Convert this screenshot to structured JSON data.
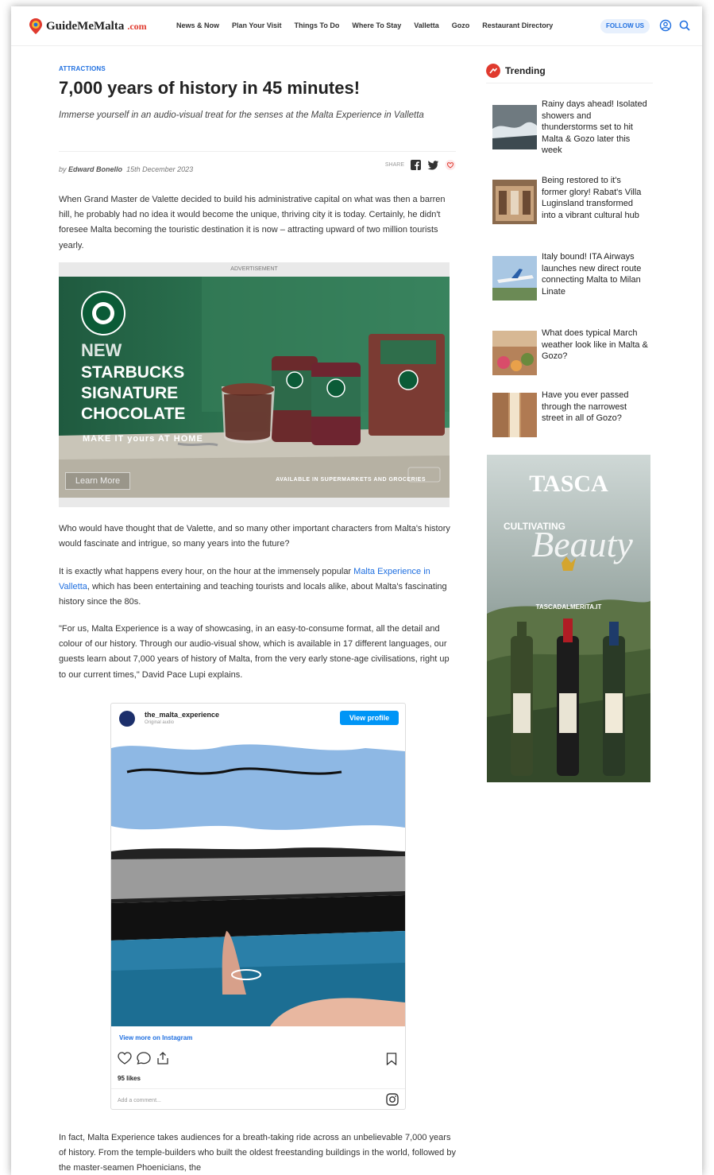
{
  "brand": {
    "name": "GuideMeMalta",
    "tld": ".com",
    "accent": "#e03a2e",
    "link": "#1f6fe0"
  },
  "nav": [
    {
      "label": "News & Now"
    },
    {
      "label": "Plan Your Visit"
    },
    {
      "label": "Things To Do"
    },
    {
      "label": "Where To Stay"
    },
    {
      "label": "Valletta"
    },
    {
      "label": "Gozo"
    },
    {
      "label": "Restaurant Directory"
    }
  ],
  "header": {
    "follow_label": "FOLLOW US",
    "account_icon": "user-circle-icon",
    "search_icon": "search-icon"
  },
  "article": {
    "category": "ATTRACTIONS",
    "title": "7,000 years of history in 45 minutes!",
    "subtitle": "Immerse yourself in an audio-visual treat for the senses at the Malta Experience in Valletta",
    "byline_prefix": "by",
    "author": "Edward Bonello",
    "date": "15th December 2023",
    "share_label": "SHARE",
    "p1": "When Grand Master de Valette decided to build his administrative capital on what was then a barren hill, he probably had no idea it would become the unique, thriving city it is today. Certainly, he didn't foresee Malta becoming the touristic destination it is now – attracting upward of two million tourists yearly.",
    "p2": "Who would have thought that de Valette, and so many other important characters from Malta's history would fascinate and intrigue, so many years into the future?",
    "p3_before": "It is exactly what happens every hour, on the hour at the immensely popular ",
    "p3_link": "Malta Experience in Valletta",
    "p3_after": ", which has been entertaining and teaching tourists and locals alike, about Malta's fascinating history since the 80s.",
    "p4": "\"For us, Malta Experience is a way of showcasing, in an easy-to-consume format, all the detail and colour of our history. Through our audio-visual show, which is available in 17 different languages, our guests learn about 7,000 years of history of Malta, from the very early stone-age civilisations, right up to our current times,\" David Pace Lupi explains.",
    "p5": "In fact, Malta Experience takes audiences for a breath-taking ride across an unbelievable 7,000 years of history. From the temple-builders who built the oldest freestanding buildings in the world, followed by the master-seamen Phoenicians, the"
  },
  "ad": {
    "label": "ADVERTISEMENT",
    "new": "NEW",
    "brand_line1": "STARBUCKS",
    "brand_line2": "SIGNATURE",
    "brand_line3": "CHOCOLATE",
    "tagline": "MAKE IT yours   AT HOME",
    "learn_more": "Learn More",
    "availability": "AVAILABLE IN SUPERMARKETS AND GROCERIES"
  },
  "instagram": {
    "username": "the_malta_experience",
    "audio": "Original audio",
    "view_profile": "View profile",
    "view_more": "View more on Instagram",
    "likes": "95 likes",
    "comment_placeholder": "Add a comment..."
  },
  "sidebar": {
    "trending_title": "Trending",
    "items": [
      {
        "title": "Rainy days ahead! Isolated showers and thunderstorms set to hit Malta & Gozo later this week"
      },
      {
        "title": "Being restored to it's former glory! Rabat's Villa Luginsland transformed into a vibrant cultural hub"
      },
      {
        "title": "Italy bound! ITA Airways launches new direct route connecting Malta to Milan Linate"
      },
      {
        "title": "What does typical March weather look like in Malta & Gozo?"
      },
      {
        "title": "Have you ever passed through the narrowest street in all of Gozo?"
      }
    ],
    "tasca": {
      "brand": "TASCA",
      "line": "CULTIVATING",
      "script": "Beauty",
      "url": "TASCADALMERITA.IT"
    }
  }
}
